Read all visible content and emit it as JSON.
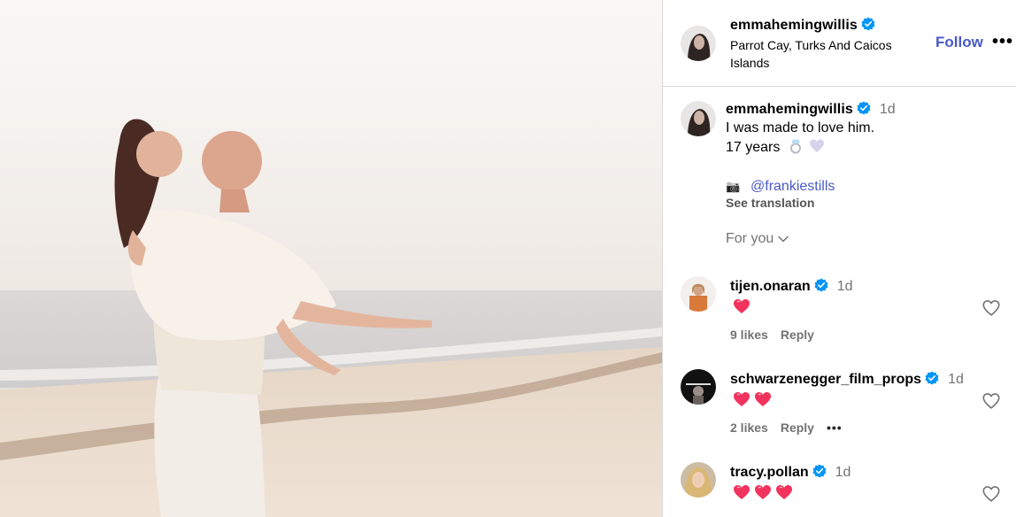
{
  "post": {
    "author": "emmahemingwillis",
    "location": "Parrot Cay, Turks And Caicos Islands",
    "follow_label": "Follow",
    "more_label": "•••"
  },
  "caption": {
    "author": "emmahemingwillis",
    "time": "1d",
    "line1": "I was made to love him.",
    "line2": "17 years",
    "line2_emojis": [
      "ring",
      "purple-heart"
    ],
    "camera_emoji": "📷",
    "mention": "@frankiestills",
    "see_translation": "See translation",
    "for_you": "For you"
  },
  "comments": [
    {
      "user": "tijen.onaran",
      "verified": true,
      "time": "1d",
      "hearts": 1,
      "likes": "9 likes",
      "reply": "Reply"
    },
    {
      "user": "schwarzenegger_film_props",
      "verified": true,
      "time": "1d",
      "hearts": 2,
      "likes": "2 likes",
      "reply": "Reply",
      "more": "•••"
    },
    {
      "user": "tracy.pollan",
      "verified": true,
      "time": "1d",
      "hearts": 3
    }
  ],
  "colors": {
    "verified": "#0095f6",
    "link": "#4a5ac7",
    "muted": "#737373",
    "heart": "#f2335d"
  },
  "icons": [
    "verified-badge-icon",
    "camera-icon",
    "chevron-down-icon",
    "heart-outline-icon",
    "heart-emoji-icon"
  ]
}
